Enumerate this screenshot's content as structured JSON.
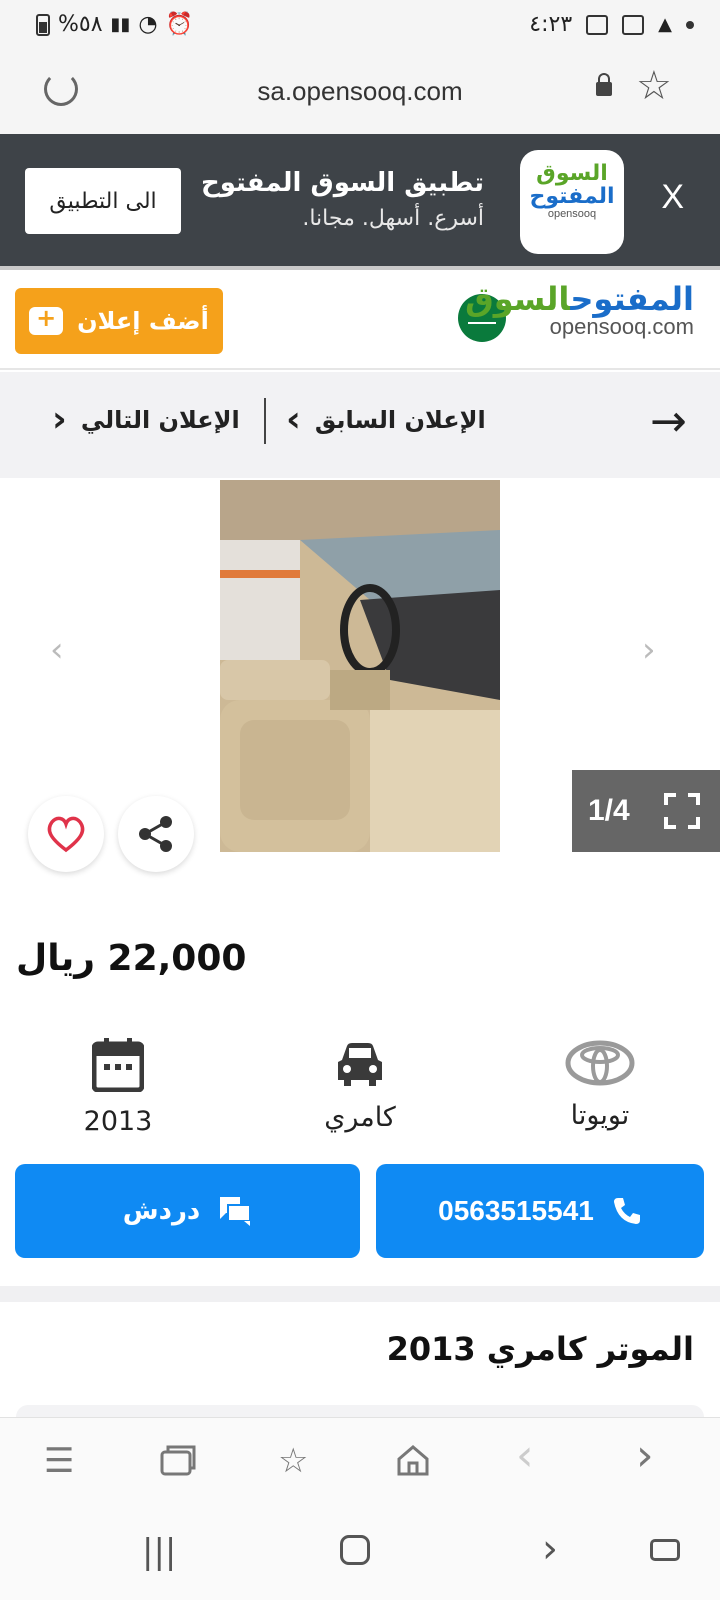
{
  "status_bar": {
    "time": "٤:٢٣",
    "battery_text": "%٥٨"
  },
  "browser": {
    "url": "sa.opensooq.com"
  },
  "app_banner": {
    "close_label": "X",
    "title": "تطبيق السوق المفتوح",
    "subtitle": "أسرع. أسهل. مجانا.",
    "open_button": "الى التطبيق",
    "logo_line1": "السوق",
    "logo_line2": "المفتوح",
    "logo_line3": "opensooq"
  },
  "site_header": {
    "add_ad_label": "أضف إعلان",
    "logo_ar_part1": "السوق",
    "logo_ar_part2": "المفتوح",
    "logo_en": "opensooq.com"
  },
  "ad_nav": {
    "previous_label": "الإعلان السابق",
    "next_label": "الإعلان التالي"
  },
  "gallery": {
    "counter": "1/4"
  },
  "listing": {
    "price": "22,000 ريال",
    "title": "الموتر كامري 2013",
    "specs": [
      {
        "icon": "toyota-logo-icon",
        "label": "تويوتا"
      },
      {
        "icon": "car-icon",
        "label": "كامري"
      },
      {
        "icon": "calendar-icon",
        "label": "2013"
      }
    ]
  },
  "actions": {
    "phone": "0563515541",
    "chat_label": "دردش"
  },
  "colors": {
    "accent_blue": "#0f8af3",
    "add_orange": "#f5a11b",
    "banner_bg": "#3e4348"
  }
}
